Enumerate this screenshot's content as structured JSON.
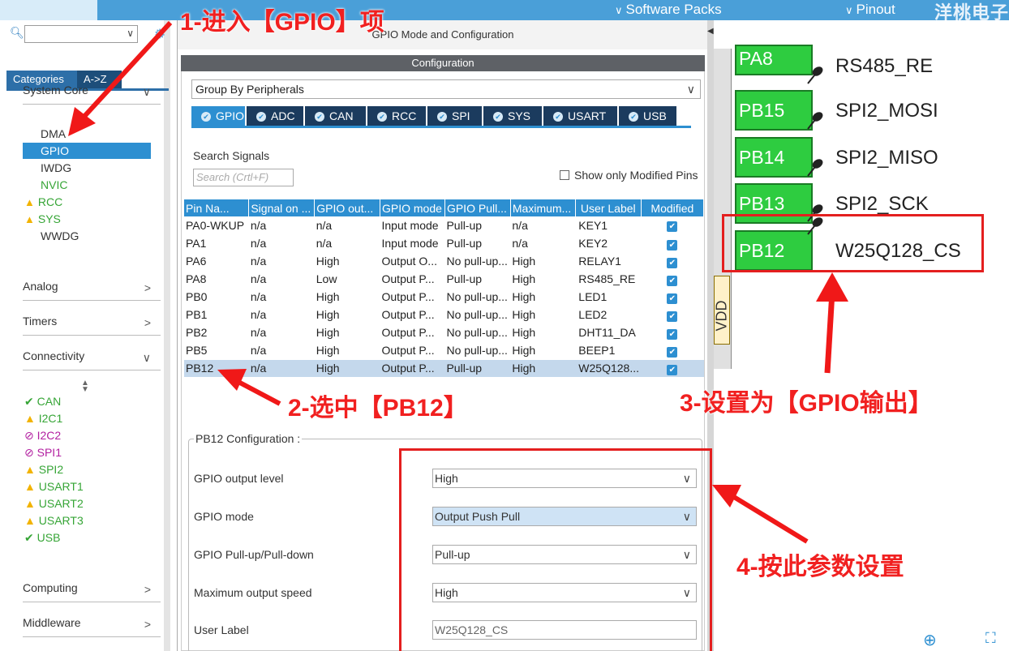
{
  "topbar": {
    "software_packs": "Software Packs",
    "pinout": "Pinout",
    "watermark": "洋桃电子"
  },
  "categories": {
    "tab_categories": "Categories",
    "tab_az": "A->Z",
    "system_core": "System Core",
    "system_core_items": [
      "DMA",
      "GPIO",
      "IWDG",
      "NVIC",
      "RCC",
      "SYS",
      "WWDG"
    ],
    "analog": "Analog",
    "timers": "Timers",
    "connectivity": "Connectivity",
    "connectivity_items": [
      {
        "label": "CAN",
        "status": "ok"
      },
      {
        "label": "I2C1",
        "status": "warn"
      },
      {
        "label": "I2C2",
        "status": "disabled"
      },
      {
        "label": "SPI1",
        "status": "disabled"
      },
      {
        "label": "SPI2",
        "status": "warn"
      },
      {
        "label": "USART1",
        "status": "warn"
      },
      {
        "label": "USART2",
        "status": "warn"
      },
      {
        "label": "USART3",
        "status": "warn"
      },
      {
        "label": "USB",
        "status": "ok"
      }
    ],
    "computing": "Computing",
    "middleware": "Middleware"
  },
  "middle": {
    "title": "GPIO Mode and Configuration",
    "config_bar": "Configuration",
    "group_by": "Group By Peripherals",
    "tabs": [
      "GPIO",
      "ADC",
      "CAN",
      "RCC",
      "SPI",
      "SYS",
      "USART",
      "USB"
    ],
    "search_label": "Search Signals",
    "search_placeholder": "Search (Crtl+F)",
    "show_modified": "Show only Modified Pins",
    "table_headers": [
      "Pin Na...",
      "Signal on ...",
      "GPIO out...",
      "GPIO mode",
      "GPIO Pull...",
      "Maximum...",
      "User Label",
      "Modified"
    ],
    "rows": [
      [
        "PA0-WKUP",
        "n/a",
        "n/a",
        "Input mode",
        "Pull-up",
        "n/a",
        "KEY1"
      ],
      [
        "PA1",
        "n/a",
        "n/a",
        "Input mode",
        "Pull-up",
        "n/a",
        "KEY2"
      ],
      [
        "PA6",
        "n/a",
        "High",
        "Output O...",
        "No pull-up...",
        "High",
        "RELAY1"
      ],
      [
        "PA8",
        "n/a",
        "Low",
        "Output P...",
        "Pull-up",
        "High",
        "RS485_RE"
      ],
      [
        "PB0",
        "n/a",
        "High",
        "Output P...",
        "No pull-up...",
        "High",
        "LED1"
      ],
      [
        "PB1",
        "n/a",
        "High",
        "Output P...",
        "No pull-up...",
        "High",
        "LED2"
      ],
      [
        "PB2",
        "n/a",
        "High",
        "Output P...",
        "No pull-up...",
        "High",
        "DHT11_DA"
      ],
      [
        "PB5",
        "n/a",
        "High",
        "Output P...",
        "No pull-up...",
        "High",
        "BEEP1"
      ],
      [
        "PB12",
        "n/a",
        "High",
        "Output P...",
        "Pull-up",
        "High",
        "W25Q128..."
      ]
    ],
    "pb_config_title": "PB12 Configuration :",
    "config_fields": [
      {
        "label": "GPIO output level",
        "value": "High"
      },
      {
        "label": "GPIO mode",
        "value": "Output Push Pull"
      },
      {
        "label": "GPIO Pull-up/Pull-down",
        "value": "Pull-up"
      },
      {
        "label": "Maximum output speed",
        "value": "High"
      },
      {
        "label": "User Label",
        "value": "W25Q128_CS"
      }
    ]
  },
  "pinout": {
    "pins": [
      {
        "name": "PA8",
        "label": "RS485_RE"
      },
      {
        "name": "PB15",
        "label": "SPI2_MOSI"
      },
      {
        "name": "PB14",
        "label": "SPI2_MISO"
      },
      {
        "name": "PB13",
        "label": "SPI2_SCK"
      },
      {
        "name": "PB12",
        "label": "W25Q128_CS"
      }
    ],
    "vdd": "VDD"
  },
  "annotations": {
    "step1": "1-进入【GPIO】项",
    "step2": "2-选中【PB12】",
    "step3": "3-设置为【GPIO输出】",
    "step4": "4-按此参数设置"
  },
  "colors": {
    "accent": "#2d8fd1",
    "pin_green": "#2ecc40",
    "annotation_red": "#f12020"
  }
}
